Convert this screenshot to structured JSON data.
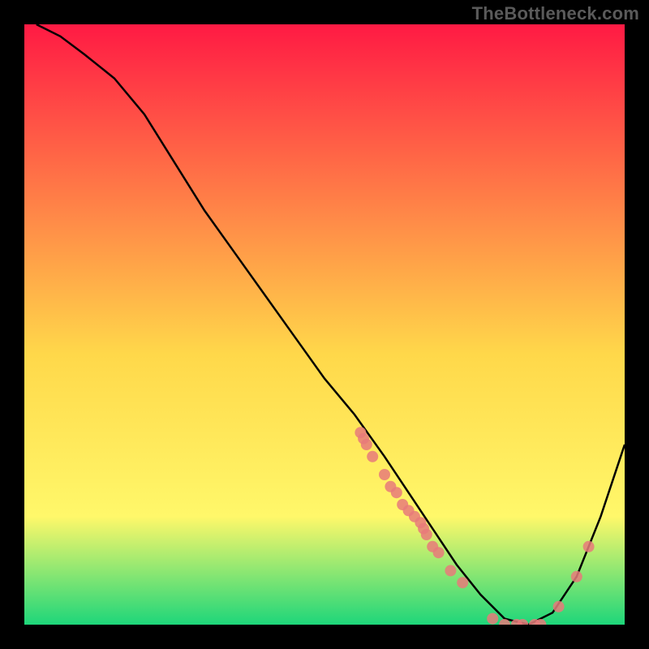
{
  "branding": {
    "watermark_text": "TheBottleneck.com"
  },
  "chart_data": {
    "type": "line",
    "title": "",
    "xlabel": "",
    "ylabel": "",
    "xlim": [
      0,
      100
    ],
    "ylim": [
      0,
      100
    ],
    "gradient_colors": {
      "top": "#ff1a44",
      "upper_mid": "#ffd84a",
      "lower_mid": "#fff86a",
      "bottom": "#1ed67a"
    },
    "curve_color": "#000000",
    "marker_color": "#e77a7a",
    "series": [
      {
        "name": "bottleneck-curve",
        "x": [
          2,
          6,
          10,
          15,
          20,
          25,
          30,
          35,
          40,
          45,
          50,
          55,
          60,
          64,
          68,
          72,
          76,
          80,
          84,
          88,
          92,
          96,
          100
        ],
        "y": [
          100,
          98,
          95,
          91,
          85,
          77,
          69,
          62,
          55,
          48,
          41,
          35,
          28,
          22,
          16,
          10,
          5,
          1,
          0,
          2,
          8,
          18,
          30
        ]
      }
    ],
    "markers": [
      {
        "x": 56,
        "y": 32
      },
      {
        "x": 56.5,
        "y": 31
      },
      {
        "x": 57,
        "y": 30
      },
      {
        "x": 58,
        "y": 28
      },
      {
        "x": 60,
        "y": 25
      },
      {
        "x": 61,
        "y": 23
      },
      {
        "x": 62,
        "y": 22
      },
      {
        "x": 63,
        "y": 20
      },
      {
        "x": 64,
        "y": 19
      },
      {
        "x": 65,
        "y": 18
      },
      {
        "x": 66,
        "y": 17
      },
      {
        "x": 66.5,
        "y": 16
      },
      {
        "x": 67,
        "y": 15
      },
      {
        "x": 68,
        "y": 13
      },
      {
        "x": 69,
        "y": 12
      },
      {
        "x": 71,
        "y": 9
      },
      {
        "x": 73,
        "y": 7
      },
      {
        "x": 78,
        "y": 1
      },
      {
        "x": 80,
        "y": 0
      },
      {
        "x": 82,
        "y": 0
      },
      {
        "x": 83,
        "y": 0
      },
      {
        "x": 85,
        "y": 0
      },
      {
        "x": 86,
        "y": 0
      },
      {
        "x": 89,
        "y": 3
      },
      {
        "x": 92,
        "y": 8
      },
      {
        "x": 94,
        "y": 13
      }
    ]
  }
}
